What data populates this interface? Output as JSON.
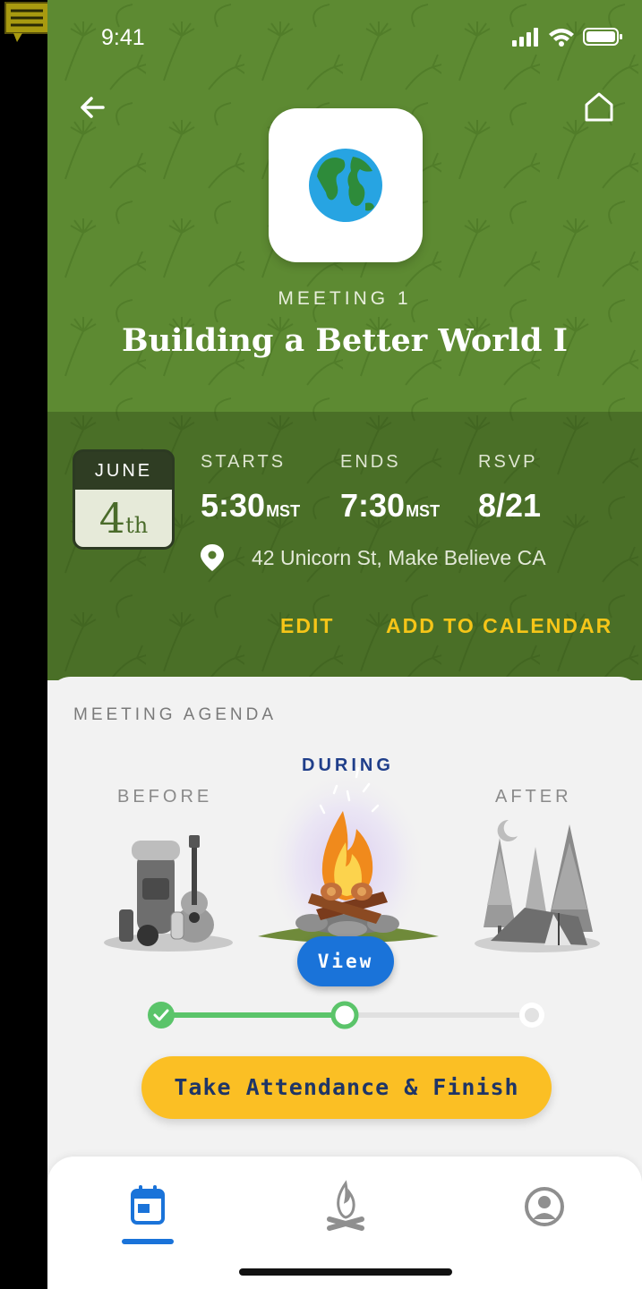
{
  "status_bar": {
    "time": "9:41"
  },
  "header": {
    "meeting_number": "MEETING 1",
    "title": "Building a Better World I"
  },
  "date": {
    "month": "JUNE",
    "day": "4",
    "suffix": "th"
  },
  "details": {
    "starts_label": "STARTS",
    "starts_time": "5:30",
    "starts_unit": "MST",
    "ends_label": "ENDS",
    "ends_time": "7:30",
    "ends_unit": "MST",
    "rsvp_label": "RSVP",
    "rsvp_date": "8/21",
    "address": "42 Unicorn St, Make Believe CA"
  },
  "actions": {
    "edit": "EDIT",
    "add_to_calendar": "ADD TO CALENDAR"
  },
  "agenda": {
    "title": "MEETING AGENDA",
    "phases": {
      "before": "BEFORE",
      "during": "DURING",
      "after": "AFTER"
    },
    "view_button": "View",
    "finish_button": "Take Attendance & Finish",
    "progress": {
      "completed_steps": 1,
      "current_step": 2,
      "total_steps": 3
    }
  },
  "colors": {
    "brand_green": "#5d8a32",
    "accent_yellow": "#f5c518",
    "accent_blue": "#1a73d9",
    "progress_green": "#5bc46a"
  },
  "tabs": [
    {
      "icon": "calendar-icon",
      "active": true
    },
    {
      "icon": "campfire-icon",
      "active": false
    },
    {
      "icon": "profile-icon",
      "active": false
    }
  ]
}
